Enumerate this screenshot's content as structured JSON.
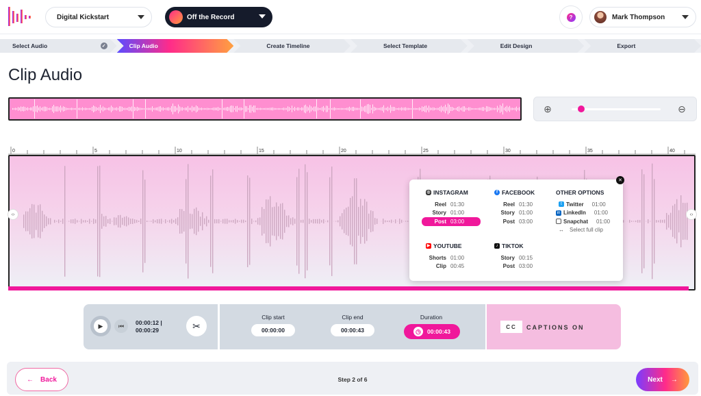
{
  "header": {
    "project_select": "Digital Kickstart",
    "episode_select": "Off the Record",
    "user_name": "Mark Thompson"
  },
  "steps": [
    {
      "label": "Select Audio",
      "state": "done"
    },
    {
      "label": "Clip Audio",
      "state": "active"
    },
    {
      "label": "Create Timeline",
      "state": "todo"
    },
    {
      "label": "Select Template",
      "state": "todo"
    },
    {
      "label": "Edit Design",
      "state": "todo"
    },
    {
      "label": "Export",
      "state": "todo"
    }
  ],
  "page_title": "Clip Audio",
  "zoom": {
    "level": 0.05
  },
  "ruler": {
    "labels": [
      "0",
      "5",
      "10",
      "15",
      "20",
      "25",
      "30",
      "35",
      "40"
    ]
  },
  "popup": {
    "instagram": {
      "title": "INSTAGRAM",
      "rows": [
        [
          "Reel",
          "01:30"
        ],
        [
          "Story",
          "01:00"
        ],
        [
          "Post",
          "03:00"
        ]
      ]
    },
    "facebook": {
      "title": "FACEBOOK",
      "rows": [
        [
          "Reel",
          "01:30"
        ],
        [
          "Story",
          "01:00"
        ],
        [
          "Post",
          "03:00"
        ]
      ]
    },
    "other": {
      "title": "OTHER OPTIONS",
      "rows": [
        [
          "Twitter",
          "01:00"
        ],
        [
          "LinkedIn",
          "01:00"
        ],
        [
          "Snapchat",
          "01:00"
        ]
      ],
      "full_clip": "Select full clip"
    },
    "youtube": {
      "title": "YOUTUBE",
      "rows": [
        [
          "Shorts",
          "01:00"
        ],
        [
          "Clip",
          "00:45"
        ]
      ]
    },
    "tiktok": {
      "title": "TIKTOK",
      "rows": [
        [
          "Story",
          "00:15"
        ],
        [
          "Post",
          "03:00"
        ]
      ]
    }
  },
  "player": {
    "current": "00:00:12 |",
    "total": "00:00:29"
  },
  "clip": {
    "start_label": "Clip start",
    "start": "00:00:00",
    "end_label": "Clip end",
    "end": "00:00:43",
    "duration_label": "Duration",
    "duration": "00:00:43"
  },
  "captions": {
    "badge": "CC",
    "label": "CAPTIONS ON"
  },
  "footer": {
    "back": "Back",
    "step": "Step 2 of 6",
    "next": "Next"
  },
  "colors": {
    "accent": "#f0189b",
    "dark": "#151b2b"
  }
}
